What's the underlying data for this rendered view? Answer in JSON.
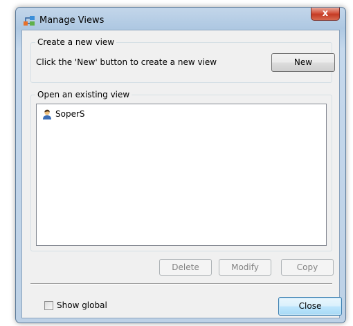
{
  "window": {
    "title": "Manage Views",
    "close_glyph": "x",
    "app_icon": "manage-views-app-icon"
  },
  "create_group": {
    "legend": "Create a new view",
    "instruction": "Click the 'New' button to create a new view",
    "new_button": "New"
  },
  "open_group": {
    "legend": "Open an existing view",
    "items": [
      {
        "label": "SoperS",
        "icon": "user-icon"
      }
    ]
  },
  "actions": {
    "delete": "Delete",
    "modify": "Modify",
    "copy": "Copy"
  },
  "footer": {
    "show_global_label": "Show global",
    "show_global_checked": false,
    "close_button": "Close"
  },
  "colors": {
    "window_frame": "#aec8e2",
    "client_bg": "#f0f0f0",
    "close_button_red": "#c43a24",
    "default_button_blue": "#3c7fb1"
  }
}
